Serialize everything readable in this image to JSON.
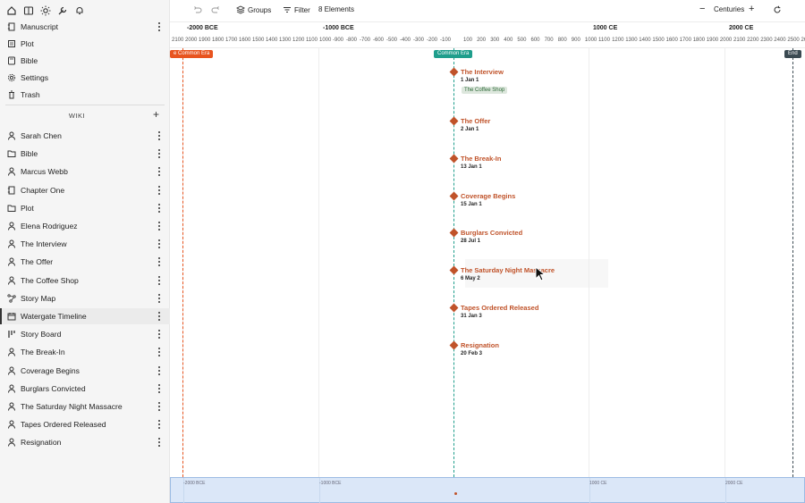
{
  "toolbar_left_icons": [
    "home-icon",
    "book-icon",
    "sun-icon",
    "wrench-icon",
    "bell-icon"
  ],
  "sidebar": {
    "top_items": [
      {
        "label": "Manuscript",
        "icon": "manuscript-icon",
        "has_menu": true
      },
      {
        "label": "Plot",
        "icon": "plot-icon"
      },
      {
        "label": "Bible",
        "icon": "bible-icon"
      },
      {
        "label": "Settings",
        "icon": "gear-icon"
      },
      {
        "label": "Trash",
        "icon": "trash-icon"
      }
    ],
    "wiki_label": "WIKI",
    "wiki_add": "+",
    "wiki_items": [
      {
        "label": "Sarah Chen",
        "icon": "person-icon"
      },
      {
        "label": "Bible",
        "icon": "folder-icon"
      },
      {
        "label": "Marcus Webb",
        "icon": "person-icon"
      },
      {
        "label": "Chapter One",
        "icon": "manuscript-icon"
      },
      {
        "label": "Plot",
        "icon": "folder-icon"
      },
      {
        "label": "Elena Rodriguez",
        "icon": "person-icon"
      },
      {
        "label": "The Interview",
        "icon": "person-icon"
      },
      {
        "label": "The Offer",
        "icon": "person-icon"
      },
      {
        "label": "The Coffee Shop",
        "icon": "person-icon"
      },
      {
        "label": "Story Map",
        "icon": "map-icon"
      },
      {
        "label": "Watergate Timeline",
        "icon": "calendar-icon",
        "active": true
      },
      {
        "label": "Story Board",
        "icon": "board-icon"
      },
      {
        "label": "The Break-In",
        "icon": "person-icon"
      },
      {
        "label": "Coverage Begins",
        "icon": "person-icon"
      },
      {
        "label": "Burglars Convicted",
        "icon": "person-icon"
      },
      {
        "label": "The Saturday Night Massacre",
        "icon": "person-icon"
      },
      {
        "label": "Tapes Ordered Released",
        "icon": "person-icon"
      },
      {
        "label": "Resignation",
        "icon": "person-icon"
      }
    ]
  },
  "topbar": {
    "groups_label": "Groups",
    "filter_label": "Filter",
    "elements_label": "8 Elements",
    "zoom_minus": "−",
    "zoom_label": "Centuries",
    "zoom_plus": "+"
  },
  "ruler": {
    "major": [
      {
        "label": "-2000 BCE"
      },
      {
        "label": "-1000 BCE"
      },
      {
        "label": "1000 CE"
      },
      {
        "label": "2000 CE"
      }
    ],
    "minor_bce": [
      "2100",
      "2000",
      "1900",
      "1800",
      "1700",
      "1600",
      "1500",
      "1400",
      "1300",
      "1200",
      "1100",
      "1000",
      "-900",
      "-800",
      "-700",
      "-600",
      "-500",
      "-400",
      "-300",
      "-200",
      "-100"
    ],
    "minor_ce": [
      "100",
      "200",
      "300",
      "400",
      "500",
      "600",
      "700",
      "800",
      "900",
      "1000",
      "1100",
      "1200",
      "1300",
      "1400",
      "1500",
      "1600",
      "1700",
      "1800",
      "1900",
      "2000",
      "2100",
      "2200",
      "2300",
      "2400",
      "2500",
      "2600"
    ]
  },
  "era_tags": {
    "common_era_left": "e Common Era",
    "common_era": "Common Era",
    "end": "End"
  },
  "colors": {
    "event": "#c0532a",
    "era_orange": "#e8541f",
    "era_teal": "#1f9e8c",
    "end_dark": "#3b4a52",
    "minimap": "#dbe7f8"
  },
  "events": [
    {
      "title": "The Interview",
      "date": "1 Jan 1",
      "tag": "The Coffee Shop"
    },
    {
      "title": "The Offer",
      "date": "2 Jan 1"
    },
    {
      "title": "The Break-In",
      "date": "13 Jan 1"
    },
    {
      "title": "Coverage Begins",
      "date": "15 Jan 1"
    },
    {
      "title": "Burglars Convicted",
      "date": "28 Jul 1"
    },
    {
      "title": "The Saturday Night Massacre",
      "date": "6 May 2"
    },
    {
      "title": "Tapes Ordered Released",
      "date": "31 Jan 3"
    },
    {
      "title": "Resignation",
      "date": "20 Feb 3"
    }
  ],
  "minimap": {
    "labels": [
      "-2000 BCE",
      "-1000 BCE",
      "1000 CE",
      "2000 CE"
    ]
  }
}
